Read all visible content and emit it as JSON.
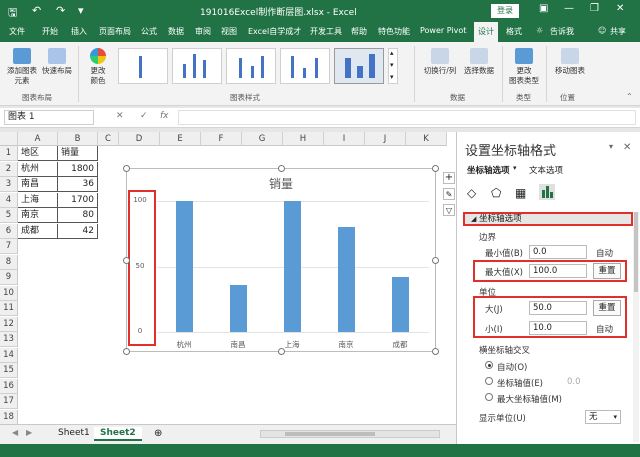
{
  "window": {
    "title": "191016Excel制作断层图.xlsx - Excel",
    "login_label": "登录",
    "min_icon": "minimize-icon",
    "restore_icon": "restore-icon",
    "close_icon": "close-icon"
  },
  "tabs": [
    "文件",
    "开始",
    "插入",
    "页面布局",
    "公式",
    "数据",
    "审阅",
    "视图",
    "Excel自学成才",
    "开发工具",
    "帮助",
    "特色功能",
    "Power Pivot",
    "设计",
    "格式"
  ],
  "active_tab": "设计",
  "tell_me": "告诉我",
  "share": "共享",
  "ribbon": {
    "add_element": "添加图表\n元素",
    "quick_layout": "快速布局",
    "change_colors": "更改\n颜色",
    "group_layouts": "图表布局",
    "group_styles": "图表样式",
    "switch_row_col": "切换行/列",
    "select_data": "选择数据",
    "group_data": "数据",
    "change_type": "更改\n图表类型",
    "group_type": "类型",
    "move_chart": "移动图表",
    "group_location": "位置"
  },
  "formula_bar": {
    "name_box": "图表 1",
    "fx": "fx"
  },
  "grid": {
    "columns": [
      "A",
      "B",
      "C",
      "D",
      "E",
      "F",
      "G",
      "H",
      "I",
      "J",
      "K"
    ],
    "rows": [
      "1",
      "2",
      "3",
      "4",
      "5",
      "6",
      "7",
      "8",
      "9",
      "10",
      "11",
      "12",
      "13",
      "14",
      "15",
      "16",
      "17",
      "18"
    ],
    "table": [
      [
        "地区",
        "销量"
      ],
      [
        "杭州",
        "1800"
      ],
      [
        "南昌",
        "36"
      ],
      [
        "上海",
        "1700"
      ],
      [
        "南京",
        "80"
      ],
      [
        "成都",
        "42"
      ]
    ]
  },
  "chart_data": {
    "type": "bar",
    "title": "销量",
    "categories": [
      "杭州",
      "南昌",
      "上海",
      "南京",
      "成都"
    ],
    "values": [
      100,
      36,
      100,
      80,
      42
    ],
    "ylim": [
      0,
      100
    ],
    "yticks": [
      "0",
      "50",
      "100"
    ],
    "grid": true,
    "bar_color": "#5b9bd5"
  },
  "sheets": [
    "Sheet1",
    "Sheet2"
  ],
  "active_sheet": "Sheet2",
  "pane": {
    "title": "设置坐标轴格式",
    "tab_axis_options": "坐标轴选项",
    "tab_text_options": "文本选项",
    "section_axis_options": "坐标轴选项",
    "bounds_label": "边界",
    "min_label": "最小值(B)",
    "min_value": "0.0",
    "min_state": "自动",
    "max_label": "最大值(X)",
    "max_value": "100.0",
    "max_state": "重置",
    "units_label": "单位",
    "major_label": "大(J)",
    "major_value": "50.0",
    "major_state": "重置",
    "minor_label": "小(I)",
    "minor_value": "10.0",
    "minor_state": "自动",
    "cross_label": "横坐标轴交叉",
    "cross_auto": "自动(O)",
    "cross_value_label": "坐标轴值(E)",
    "cross_value": "0.0",
    "cross_max": "最大坐标轴值(M)",
    "display_unit_label": "显示单位(U)",
    "display_unit_value": "无"
  },
  "accent_color": "#217346",
  "highlight_color": "#e0302a"
}
